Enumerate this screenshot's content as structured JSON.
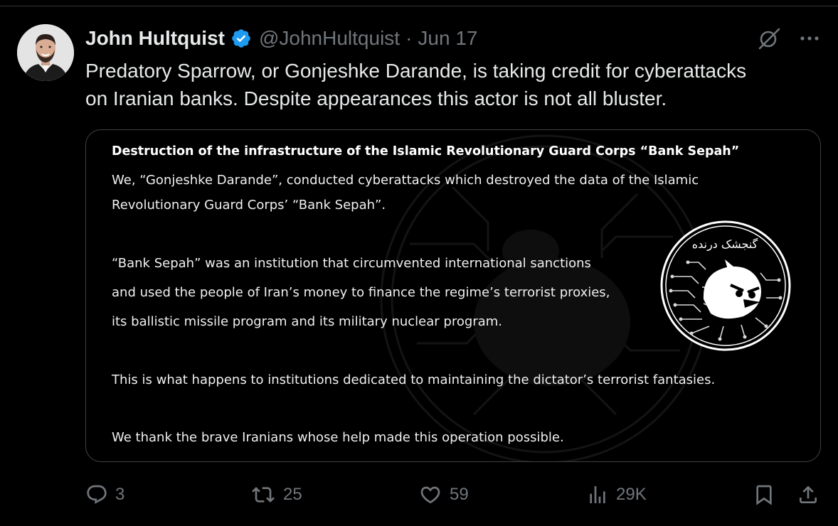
{
  "author": {
    "display_name": "John Hultquist",
    "handle": "@JohnHultquist",
    "separator": "·",
    "date": "Jun 17"
  },
  "tweet": {
    "text_line1": "Predatory Sparrow, or Gonjeshke Darande, is taking credit for cyberattacks",
    "text_line2": "on Iranian banks. Despite appearances this actor is not all bluster."
  },
  "media": {
    "title": "Destruction of the infrastructure of the Islamic Revolutionary Guard Corps “Bank Sepah”",
    "p1_line1": "We, “Gonjeshke Darande”, conducted cyberattacks which destroyed the data of the Islamic",
    "p1_line2": "Revolutionary Guard Corps’ “Bank Sepah”.",
    "p2_line1": "“Bank Sepah” was an institution that circumvented international sanctions",
    "p2_line2": "and used the people of Iran’s money to finance the regime’s terrorist proxies,",
    "p2_line3": "its ballistic missile program and its military nuclear program.",
    "p3": "This is what happens to institutions dedicated to maintaining the dictator’s terrorist fantasies.",
    "p4": "We thank the brave Iranians whose help made this operation possible.",
    "logo_text": "گنجشک درنده"
  },
  "actions": {
    "replies": "3",
    "reposts": "25",
    "likes": "59",
    "views": "29K"
  },
  "colors": {
    "background": "#000000",
    "text": "#e7e9ea",
    "muted": "#71767b",
    "verified": "#1d9bf0",
    "border": "#3e4144"
  },
  "icons": [
    "verified-badge-icon",
    "grok-icon",
    "more-icon",
    "reply-icon",
    "repost-icon",
    "like-icon",
    "views-icon",
    "bookmark-icon",
    "share-icon"
  ]
}
